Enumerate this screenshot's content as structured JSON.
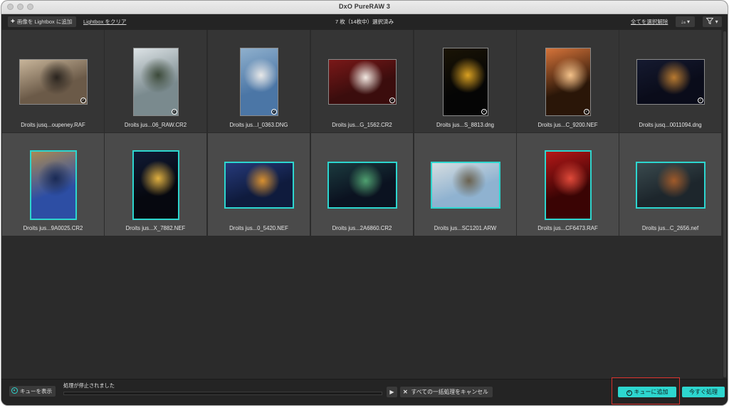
{
  "window": {
    "title": "DxO PureRAW 3"
  },
  "toolbar": {
    "add_images_label": "画像を Lightbox に追加",
    "clear_lightbox_label": "Lightbox をクリア",
    "selection_status": "7 枚（14枚中）選択済み",
    "deselect_all_label": "全てを選択解除",
    "sort_icon": "sort-icon",
    "filter_icon": "filter-icon"
  },
  "grid": {
    "rows": [
      {
        "selected": false,
        "items": [
          {
            "caption": "Droits jusq...oupeney.RAF",
            "colors": [
              "#6b5a48",
              "#c8b59a",
              "#2a241e"
            ]
          },
          {
            "caption": "Droits jus...06_RAW.CR2",
            "colors": [
              "#7a8a8e",
              "#dde3e6",
              "#3c4a3a"
            ]
          },
          {
            "caption": "Droits jus...l_0363.DNG",
            "colors": [
              "#4b76a6",
              "#8fb0cd",
              "#e8e8e8"
            ]
          },
          {
            "caption": "Droits jus...G_1562.CR2",
            "colors": [
              "#3b0d0d",
              "#7a1818",
              "#f2e9e2"
            ]
          },
          {
            "caption": "Droits jus...S_8813.dng",
            "colors": [
              "#050505",
              "#1a1405",
              "#d9a021"
            ]
          },
          {
            "caption": "Droits jus...C_9200.NEF",
            "colors": [
              "#2a1608",
              "#d7743a",
              "#f4c28a"
            ]
          },
          {
            "caption": "Droits jusq...0011094.dng",
            "colors": [
              "#0a0c1a",
              "#151a30",
              "#b87a30"
            ]
          }
        ]
      },
      {
        "selected": true,
        "items": [
          {
            "caption": "Droits jus...9A0025.CR2",
            "colors": [
              "#2d4ea4",
              "#a98a55",
              "#1a2a55"
            ]
          },
          {
            "caption": "Droits jus...X_7882.NEF",
            "colors": [
              "#06080f",
              "#101a35",
              "#e0b040"
            ]
          },
          {
            "caption": "Droits jus...0_5420.NEF",
            "colors": [
              "#0f1b3d",
              "#263a7a",
              "#d89030"
            ]
          },
          {
            "caption": "Droits jus...2A6860.CR2",
            "colors": [
              "#0b1220",
              "#1b3a3e",
              "#4fa070"
            ]
          },
          {
            "caption": "Droits jus...SC1201.ARW",
            "colors": [
              "#8fb2d0",
              "#d6dde0",
              "#6a6250"
            ]
          },
          {
            "caption": "Droits jus...CF6473.RAF",
            "colors": [
              "#3a0404",
              "#b51818",
              "#e04a3a"
            ]
          },
          {
            "caption": "Droits jus...C_2656.nef",
            "colors": [
              "#1d262c",
              "#3a4a4e",
              "#a05a2a"
            ]
          }
        ]
      }
    ]
  },
  "bottombar": {
    "show_queue_label": "キューを表示",
    "status": "処理が停止されました",
    "progress": 0,
    "cancel_all_label": "すべての一括処理をキャンセル",
    "add_to_queue_label": "キューに追加",
    "process_now_label": "今すぐ処理"
  },
  "colors": {
    "accent": "#2dd6cf",
    "highlight": "#d8312c"
  }
}
